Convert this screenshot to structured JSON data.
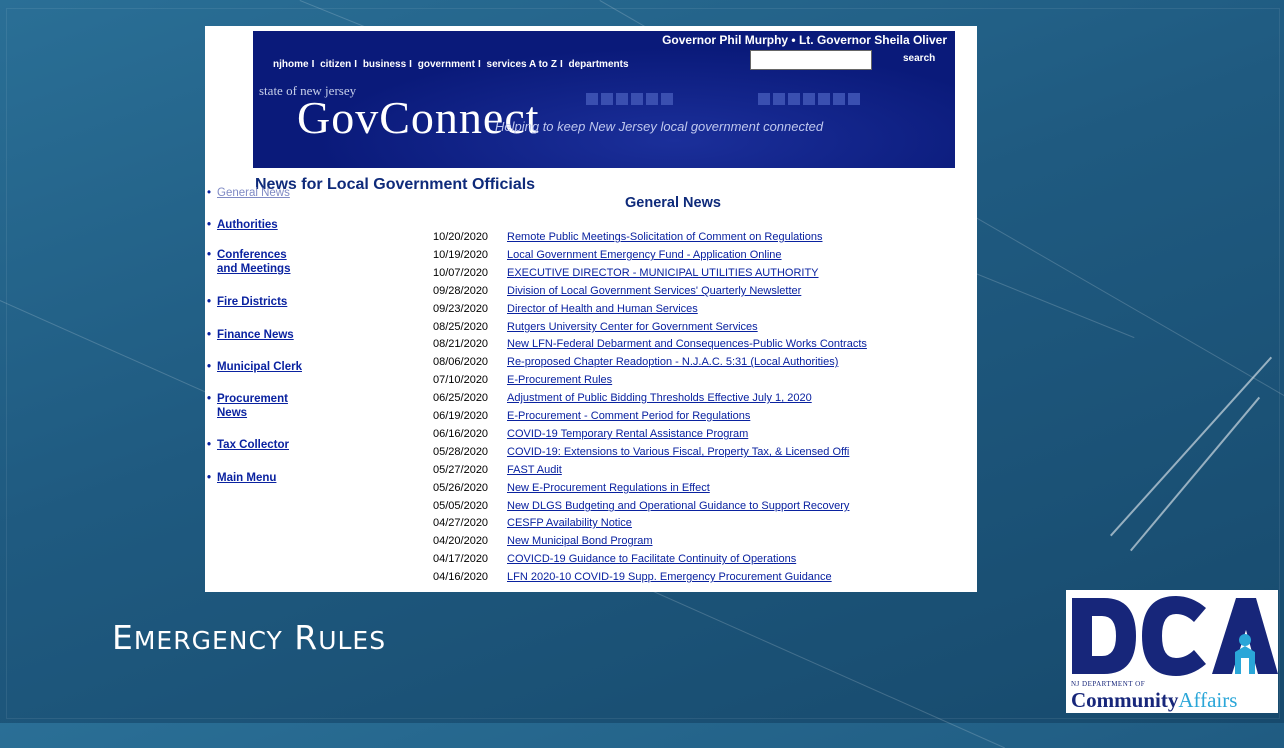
{
  "header": {
    "governor_line": "Governor Phil Murphy • Lt. Governor Sheila Oliver",
    "nav": [
      "njhome",
      "citizen",
      "business",
      "government",
      "services A to Z",
      "departments"
    ],
    "search_value": "",
    "search_label": "search"
  },
  "banner": {
    "state_label": "state of new jersey",
    "title": "GovConnect",
    "tagline": "Helping to keep New Jersey local government connected"
  },
  "page_title": "News for Local Government Officials",
  "sidebar": [
    {
      "label": "General News",
      "current": true
    },
    {
      "label": "Authorities"
    },
    {
      "label": "Conferences and Meetings"
    },
    {
      "label": "Fire Districts"
    },
    {
      "label": "Finance News"
    },
    {
      "label": "Municipal Clerk"
    },
    {
      "label": "Procurement News"
    },
    {
      "label": "Tax Collector"
    },
    {
      "label": "Main Menu"
    }
  ],
  "section_title": "General News",
  "news": [
    {
      "date": "10/20/2020",
      "title": "Remote Public Meetings-Solicitation of Comment on Regulations"
    },
    {
      "date": "10/19/2020",
      "title": "Local Government Emergency Fund - Application Online"
    },
    {
      "date": "10/07/2020",
      "title": "EXECUTIVE DIRECTOR - MUNICIPAL UTILITIES AUTHORITY"
    },
    {
      "date": "09/28/2020",
      "title": "Division of Local Government Services' Quarterly Newsletter"
    },
    {
      "date": "09/23/2020",
      "title": "Director of Health and Human Services"
    },
    {
      "date": "08/25/2020",
      "title": "Rutgers University Center for Government Services"
    },
    {
      "date": "08/21/2020",
      "title": "New LFN-Federal Debarment and Consequences-Public Works Contracts"
    },
    {
      "date": "08/06/2020",
      "title": "Re-proposed Chapter Readoption - N.J.A.C. 5:31 (Local Authorities)"
    },
    {
      "date": "07/10/2020",
      "title": "E-Procurement Rules",
      "highlighted": true
    },
    {
      "date": "06/25/2020",
      "title": "Adjustment of Public Bidding Thresholds Effective July 1, 2020"
    },
    {
      "date": "06/19/2020",
      "title": "E-Procurement - Comment Period for Regulations",
      "highlighted": true
    },
    {
      "date": "06/16/2020",
      "title": "COVID-19 Temporary Rental Assistance Program"
    },
    {
      "date": "05/28/2020",
      "title": "COVID-19: Extensions to Various Fiscal, Property Tax, & Licensed Offi"
    },
    {
      "date": "05/27/2020",
      "title": "FAST Audit"
    },
    {
      "date": "05/26/2020",
      "title": "New E-Procurement Regulations in Effect",
      "highlighted": true
    },
    {
      "date": "05/05/2020",
      "title": "New DLGS Budgeting and Operational Guidance to Support Recovery"
    },
    {
      "date": "04/27/2020",
      "title": "CESFP Availability Notice"
    },
    {
      "date": "04/20/2020",
      "title": "New Municipal Bond Program"
    },
    {
      "date": "04/17/2020",
      "title": "COVICD-19 Guidance to Facilitate Continuity of Operations"
    },
    {
      "date": "04/16/2020",
      "title": "LFN 2020-10 COVID-19 Supp. Emergency Procurement Guidance"
    }
  ],
  "slide_title": "Emergency Rules",
  "logo": {
    "letters": "DCA",
    "dept_line": "NJ DEPARTMENT OF",
    "name_part1": "Community",
    "name_part2": "Affairs"
  },
  "colors": {
    "background": "#1f5a80",
    "banner": "#0a1a7a",
    "link": "#0a22a0",
    "highlight": "#fffa9e",
    "logo_navy": "#17267a",
    "logo_cyan": "#2aa6d8"
  }
}
